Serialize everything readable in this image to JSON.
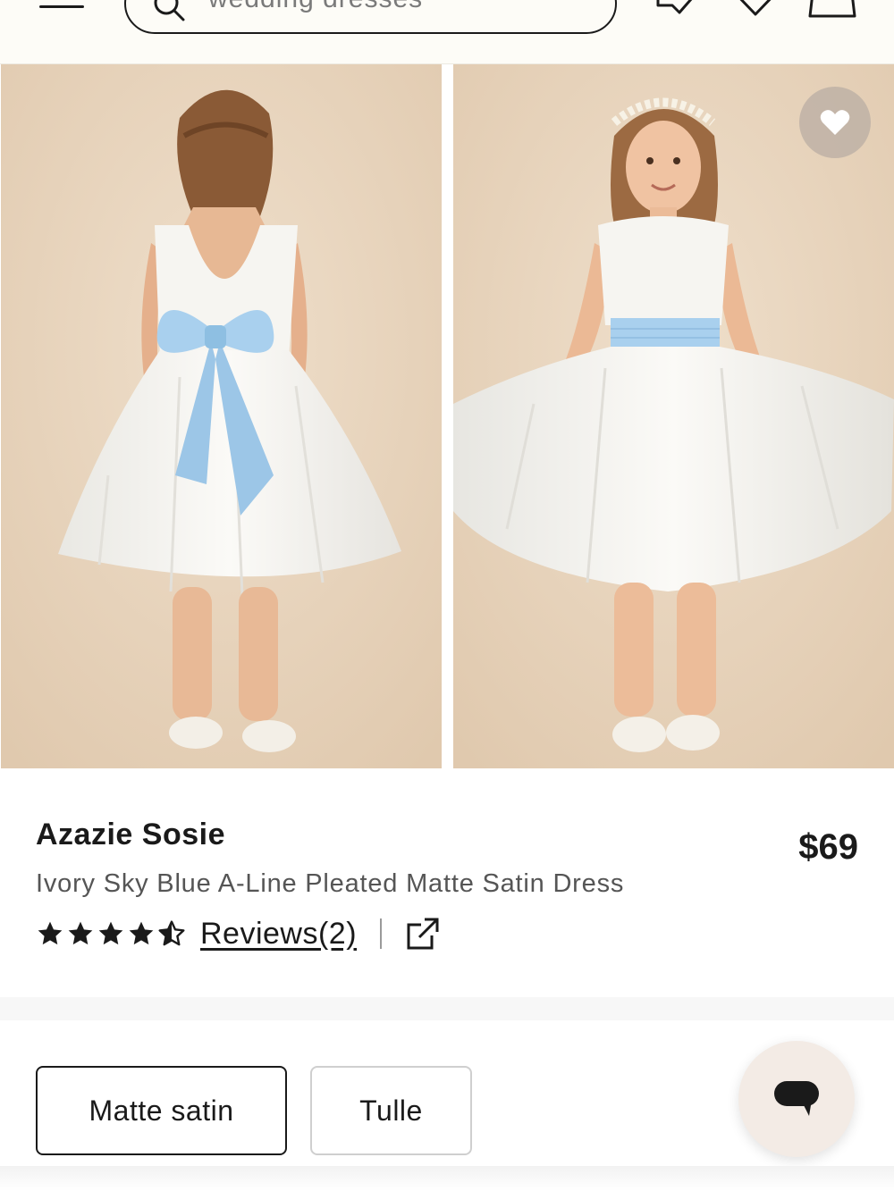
{
  "header": {
    "search_placeholder": "wedding dresses"
  },
  "product": {
    "brand": "Azazie Sosie",
    "name": "Ivory Sky Blue A-Line Pleated Matte Satin Dress",
    "price": "$69",
    "rating": 4.5,
    "reviews_label": "Reviews(2)"
  },
  "fabric_options": [
    {
      "label": "Matte satin",
      "selected": true
    },
    {
      "label": "Tulle",
      "selected": false
    }
  ],
  "colors": {
    "background_photo": "#e9d7c0",
    "dress_white": "#f7f6f2",
    "sash_blue": "#a9d0ee",
    "text": "#1a1a1a"
  },
  "icons": [
    "menu-icon",
    "search-icon",
    "tag-icon",
    "heart-icon",
    "bag-icon",
    "favorite-heart-icon",
    "star-icon",
    "half-star-icon",
    "share-icon",
    "chat-icon"
  ]
}
